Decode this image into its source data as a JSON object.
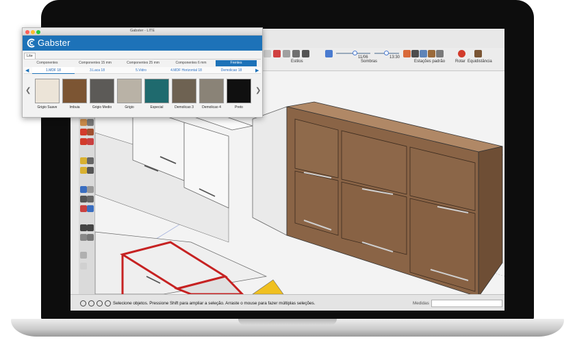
{
  "gabster": {
    "window_title": "Gabster - LITE",
    "logo": "Gabster",
    "lite_tab": "Lite",
    "categories": [
      "Componentes",
      "Componentes 15 mm",
      "Componentes 25 mm",
      "Componentes 6 mm",
      "Frentes"
    ],
    "active_category": 4,
    "materials": [
      "1.MDF 18",
      "3.Laca 18",
      "5.Vidro",
      "4.MDF Horizontal 18",
      "Demolicao 18"
    ],
    "active_material": 0,
    "swatches": [
      {
        "label": "Grigio Suave",
        "color": "#ece4d8"
      },
      {
        "label": "Imbuia",
        "color": "#7c5533"
      },
      {
        "label": "Grigio Medio",
        "color": "#5c5a57"
      },
      {
        "label": "Grigio",
        "color": "#b9b2a6"
      },
      {
        "label": "Especial",
        "color": "#1f6a6e"
      },
      {
        "label": "Demolicao 3",
        "color": "#6e6252"
      },
      {
        "label": "Demolicao 4",
        "color": "#8a8377"
      },
      {
        "label": "Preto",
        "color": "#101010"
      }
    ]
  },
  "sketchup": {
    "toolbar_labels": [
      "Estilos",
      "Sombras",
      "Estações padrão",
      "Rotar",
      "Equidistância"
    ],
    "time_1": "11/06",
    "time_2": "13:30",
    "status_text": "Selecione objetos. Pressione Shift para ampliar a seleção. Arraste o mouse para fazer múltiplas seleções.",
    "measures_label": "Medidas"
  },
  "colors": {
    "gabster_blue": "#1d72b8",
    "cabinet_wood": "#8a6446",
    "selection_red": "#c62222"
  }
}
